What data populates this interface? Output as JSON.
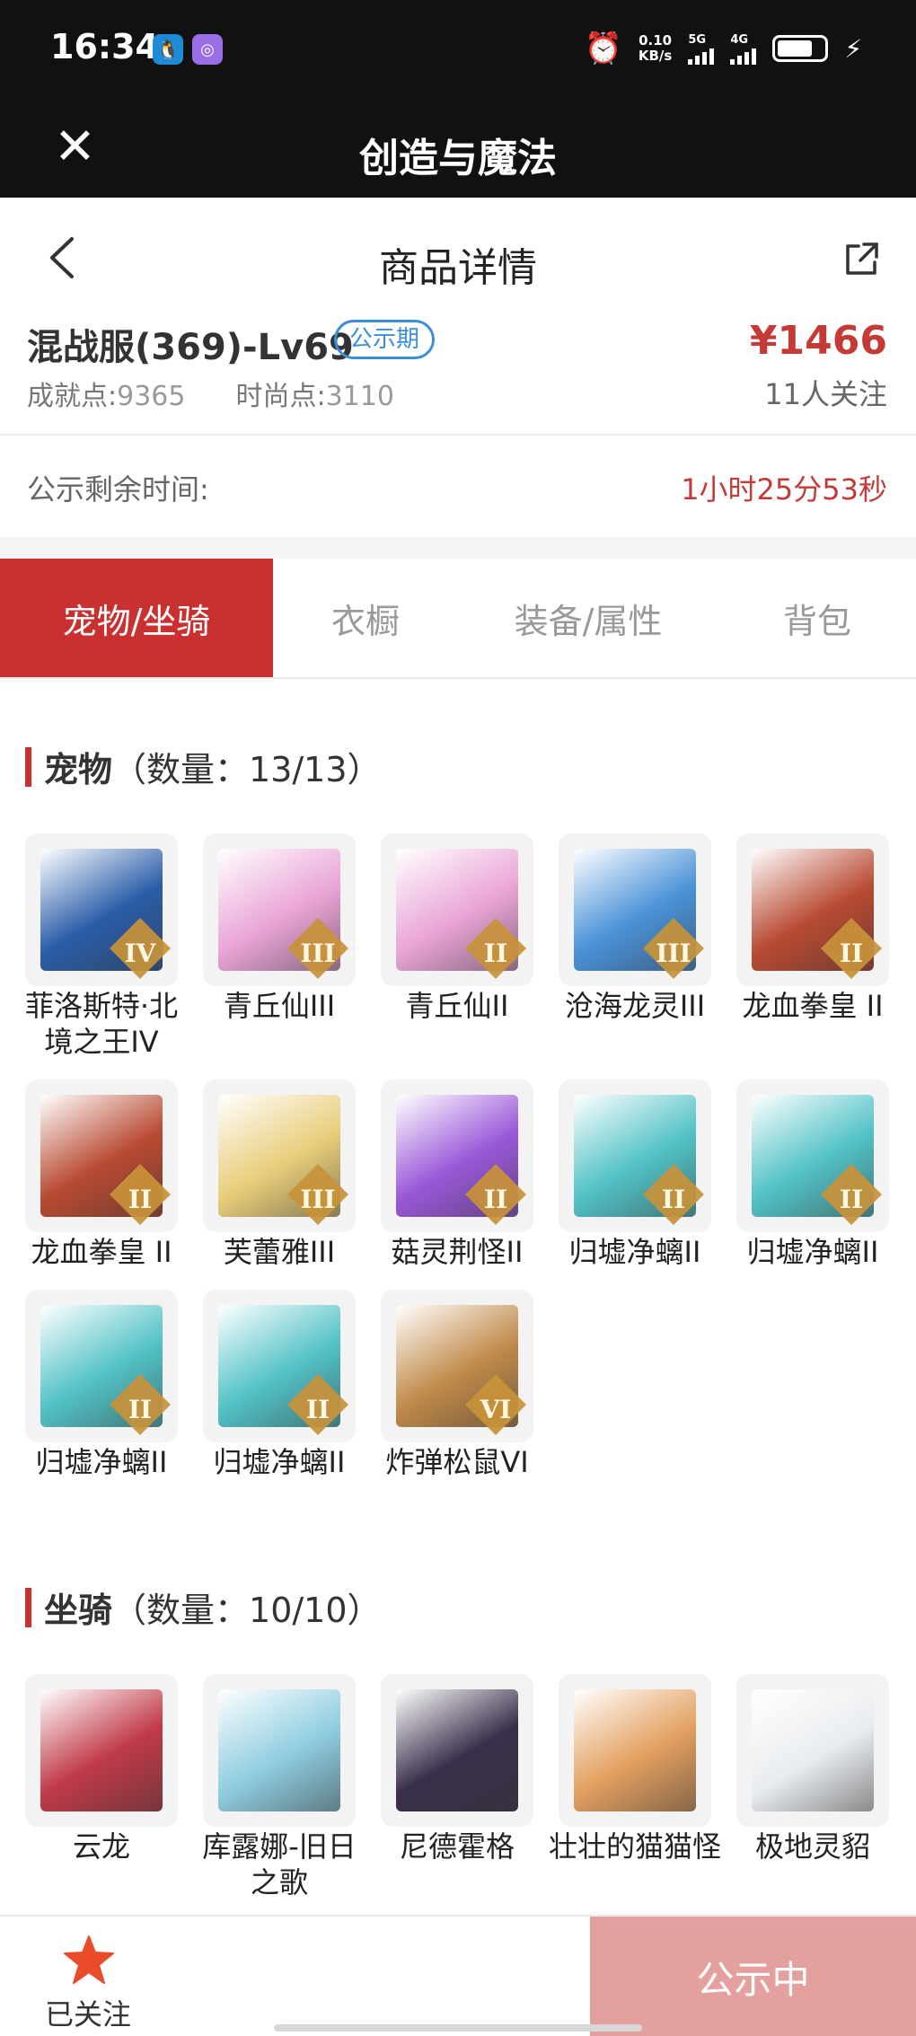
{
  "status_bar": {
    "time": "16:34",
    "speed_value": "0.10",
    "speed_unit": "KB/s",
    "net1": "5G",
    "net2": "4G"
  },
  "app_bar": {
    "title": "创造与魔法",
    "close_icon": "close-icon"
  },
  "page_header": {
    "title": "商品详情",
    "back_icon": "chevron-left-icon",
    "share_icon": "share-icon"
  },
  "product": {
    "name": "混战服(369)-Lv69",
    "badge": "公示期",
    "achievement_label": "成就点:",
    "achievement_value": "9365",
    "fashion_label": "时尚点:",
    "fashion_value": "3110",
    "price": "¥1466",
    "followers": "11人关注"
  },
  "remaining": {
    "label": "公示剩余时间:",
    "value": "1小时25分53秒"
  },
  "tabs": [
    {
      "label": "宠物/坐骑",
      "active": true
    },
    {
      "label": "衣橱",
      "active": false
    },
    {
      "label": "装备/属性",
      "active": false
    },
    {
      "label": "背包",
      "active": false
    }
  ],
  "pets": {
    "title": "宠物",
    "count": "（数量：13/13）",
    "items": [
      {
        "name": "菲洛斯特·北境之王IV",
        "rank": "IV",
        "color": "#2a5da8"
      },
      {
        "name": "青丘仙III",
        "rank": "III",
        "color": "#e9a4d6"
      },
      {
        "name": "青丘仙II",
        "rank": "II",
        "color": "#e9a4d6"
      },
      {
        "name": "沧海龙灵III",
        "rank": "III",
        "color": "#4a92d8"
      },
      {
        "name": "龙血拳皇 II",
        "rank": "II",
        "color": "#b84a32"
      },
      {
        "name": "龙血拳皇 II",
        "rank": "II",
        "color": "#b84a32"
      },
      {
        "name": "芙蕾雅III",
        "rank": "III",
        "color": "#e8cd7a"
      },
      {
        "name": "菇灵荆怪II",
        "rank": "II",
        "color": "#9a58d8"
      },
      {
        "name": "归墟净螭II",
        "rank": "II",
        "color": "#52c2c6"
      },
      {
        "name": "归墟净螭II",
        "rank": "II",
        "color": "#52c2c6"
      },
      {
        "name": "归墟净螭II",
        "rank": "II",
        "color": "#52c2c6"
      },
      {
        "name": "归墟净螭II",
        "rank": "II",
        "color": "#52c2c6"
      },
      {
        "name": "炸弹松鼠VI",
        "rank": "VI",
        "color": "#c08a4a"
      }
    ]
  },
  "mounts": {
    "title": "坐骑",
    "count": "（数量：10/10）",
    "items": [
      {
        "name": "云龙",
        "color": "#c03a48"
      },
      {
        "name": "库露娜-旧日之歌",
        "color": "#8fcde0"
      },
      {
        "name": "尼德霍格",
        "color": "#3a2f4a"
      },
      {
        "name": "壮壮的猫猫怪",
        "color": "#e3a060"
      },
      {
        "name": "极地灵貂",
        "color": "#e9ecef"
      }
    ]
  },
  "bottom_bar": {
    "follow_label": "已关注",
    "cta_label": "公示中",
    "star_icon": "star-icon"
  },
  "colors": {
    "accent": "#c8312f",
    "price": "#c33a36",
    "badge": "#3b8fd9",
    "cta": "#e4a09f"
  }
}
